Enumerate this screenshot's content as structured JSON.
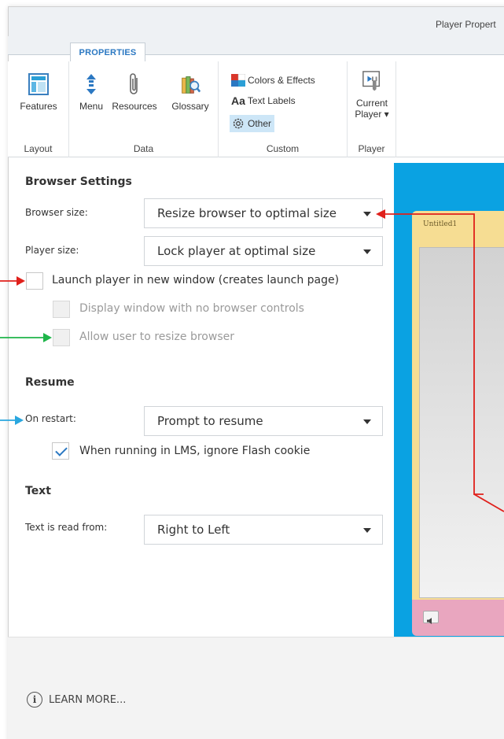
{
  "window": {
    "title": "Player Propert"
  },
  "ribbon": {
    "tab": "PROPERTIES",
    "groups": [
      {
        "label": "Layout",
        "buttons": [
          {
            "label": "Features",
            "icon": "features-icon"
          }
        ]
      },
      {
        "label": "Data",
        "buttons": [
          {
            "label": "Menu",
            "icon": "menu-icon"
          },
          {
            "label": "Resources",
            "icon": "paperclip-icon"
          },
          {
            "label": "Glossary",
            "icon": "glossary-icon"
          }
        ]
      },
      {
        "label": "Custom",
        "buttons": [
          {
            "label": "Colors & Effects",
            "icon": "colors-icon"
          },
          {
            "label": "Text Labels",
            "icon": "text-labels-icon",
            "prefix": "Aa"
          },
          {
            "label": "Other",
            "icon": "gear-icon",
            "active": true
          }
        ]
      },
      {
        "label": "Player",
        "buttons": [
          {
            "label_line1": "Current",
            "label_line2": "Player ▾",
            "icon": "current-player-icon"
          }
        ]
      }
    ]
  },
  "browser_settings": {
    "heading": "Browser Settings",
    "browser_size": {
      "label": "Browser size:",
      "value": "Resize browser to optimal size"
    },
    "player_size": {
      "label": "Player size:",
      "value": "Lock player at optimal size"
    },
    "launch_new_window": {
      "label": "Launch player in new window (creates launch page)",
      "checked": false
    },
    "no_browser_controls": {
      "label": "Display window with no browser controls",
      "checked": false,
      "disabled": true
    },
    "allow_resize": {
      "label": "Allow user to resize browser",
      "checked": false,
      "disabled": true
    }
  },
  "resume": {
    "heading": "Resume",
    "on_restart": {
      "label": "On restart:",
      "value": "Prompt to resume"
    },
    "ignore_flash_cookie": {
      "label": "When running in LMS, ignore Flash cookie",
      "checked": true
    }
  },
  "text": {
    "heading": "Text",
    "read_from": {
      "label": "Text is read from:",
      "value": "Right to Left"
    }
  },
  "preview": {
    "slide_title": "Untitled1"
  },
  "footer": {
    "learn_more": "LEARN MORE..."
  },
  "colors": {
    "accent": "#2b78c2",
    "preview_bg": "#0aa2e2",
    "arrow_red": "#e0201b",
    "arrow_green": "#1fb54a",
    "arrow_blue": "#2aa7df"
  }
}
